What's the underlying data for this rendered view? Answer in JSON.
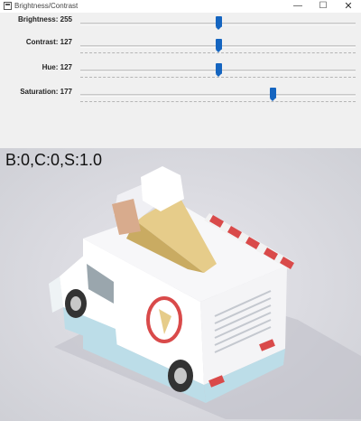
{
  "window": {
    "title": "Brightness/Contrast"
  },
  "titlebar": {
    "minimize_glyph": "—",
    "maximize_glyph": "☐",
    "close_glyph": "✕"
  },
  "controls": [
    {
      "label": "Brightness: 255",
      "value": 255,
      "max": 510
    },
    {
      "label": "Contrast: 127",
      "value": 127,
      "max": 254
    },
    {
      "label": "Hue: 127",
      "value": 127,
      "max": 254
    },
    {
      "label": "Saturation: 177",
      "value": 177,
      "max": 254
    }
  ],
  "image": {
    "overlay_text": "B:0,C:0,S:1.0"
  },
  "colors": {
    "thumb": "#1565c0",
    "truck_body": "#ffffff",
    "truck_lower": "#bcdde8",
    "ice_cream": "#e6cc8a",
    "stripes": "#d94a4a"
  }
}
